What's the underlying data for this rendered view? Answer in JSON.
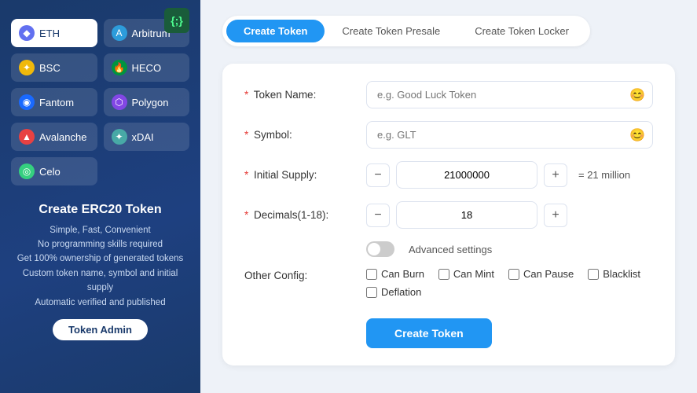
{
  "sidebar": {
    "logo_symbol": "{;}",
    "networks": [
      {
        "id": "eth",
        "label": "ETH",
        "icon": "◆",
        "icon_class": "icon-eth",
        "active": true
      },
      {
        "id": "arbitrum",
        "label": "Arbitrum",
        "icon": "✦",
        "icon_class": "icon-arb",
        "active": false
      },
      {
        "id": "bsc",
        "label": "BSC",
        "icon": "✦",
        "icon_class": "icon-bsc",
        "active": false
      },
      {
        "id": "heco",
        "label": "HECO",
        "icon": "🔥",
        "icon_class": "icon-heco",
        "active": false
      },
      {
        "id": "fantom",
        "label": "Fantom",
        "icon": "◉",
        "icon_class": "icon-fantom",
        "active": false
      },
      {
        "id": "polygon",
        "label": "Polygon",
        "icon": "⬡",
        "icon_class": "icon-polygon",
        "active": false
      },
      {
        "id": "avalanche",
        "label": "Avalanche",
        "icon": "▲",
        "icon_class": "icon-avax",
        "active": false
      },
      {
        "id": "xdai",
        "label": "xDAI",
        "icon": "✦",
        "icon_class": "icon-xdai",
        "active": false
      },
      {
        "id": "celo",
        "label": "Celo",
        "icon": "◎",
        "icon_class": "icon-celo",
        "active": false
      }
    ],
    "info_title": "Create ERC20 Token",
    "info_lines": [
      "Simple, Fast, Convenient",
      "No programming skills required",
      "Get 100% ownership of generated tokens",
      "Custom token name, symbol and initial supply",
      "Automatic verified and published"
    ],
    "token_admin_label": "Token Admin"
  },
  "tabs": [
    {
      "id": "create-token",
      "label": "Create Token",
      "active": true
    },
    {
      "id": "create-token-presale",
      "label": "Create Token Presale",
      "active": false
    },
    {
      "id": "create-token-locker",
      "label": "Create Token Locker",
      "active": false
    }
  ],
  "form": {
    "token_name_label": "Token Name:",
    "token_name_placeholder": "e.g. Good Luck Token",
    "symbol_label": "Symbol:",
    "symbol_placeholder": "e.g. GLT",
    "initial_supply_label": "Initial Supply:",
    "initial_supply_value": "21000000",
    "initial_supply_hint": "= 21 million",
    "decimals_label": "Decimals(1-18):",
    "decimals_value": "18",
    "advanced_label": "Advanced settings",
    "other_config_label": "Other Config:",
    "checkboxes": [
      {
        "id": "can-burn",
        "label": "Can Burn"
      },
      {
        "id": "can-mint",
        "label": "Can Mint"
      },
      {
        "id": "can-pause",
        "label": "Can Pause"
      },
      {
        "id": "blacklist",
        "label": "Blacklist"
      },
      {
        "id": "deflation",
        "label": "Deflation"
      }
    ],
    "create_btn_label": "Create Token"
  },
  "icons": {
    "minus": "−",
    "plus": "+",
    "emoji": "😊"
  }
}
